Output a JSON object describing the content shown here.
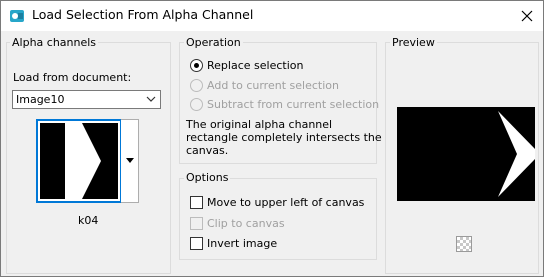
{
  "window": {
    "title": "Load Selection From Alpha Channel",
    "close_icon": "close-icon",
    "app_icon": "paintshop-app-icon"
  },
  "alpha_channels": {
    "group_title": "Alpha channels",
    "load_from_label": "Load from document:",
    "document_selected": "Image10",
    "thumbnail_caption": "k04"
  },
  "operation": {
    "group_title": "Operation",
    "options": [
      {
        "label": "Replace selection",
        "checked": true,
        "enabled": true
      },
      {
        "label": "Add to current selection",
        "checked": false,
        "enabled": false
      },
      {
        "label": "Subtract from current selection",
        "checked": false,
        "enabled": false
      }
    ],
    "message_lines": [
      "The original alpha channel",
      "rectangle completely intersects the",
      "canvas."
    ]
  },
  "options": {
    "group_title": "Options",
    "items": [
      {
        "label": "Move to upper left of canvas",
        "checked": false,
        "enabled": true
      },
      {
        "label": "Clip to canvas",
        "checked": false,
        "enabled": false
      },
      {
        "label": "Invert image",
        "checked": false,
        "enabled": true
      }
    ]
  },
  "preview": {
    "group_title": "Preview",
    "background_icon": "transparency-checker-icon"
  },
  "colors": {
    "accent": "#0078d7",
    "window_bg": "#f0f0f0",
    "disabled_text": "#a0a0a0"
  }
}
